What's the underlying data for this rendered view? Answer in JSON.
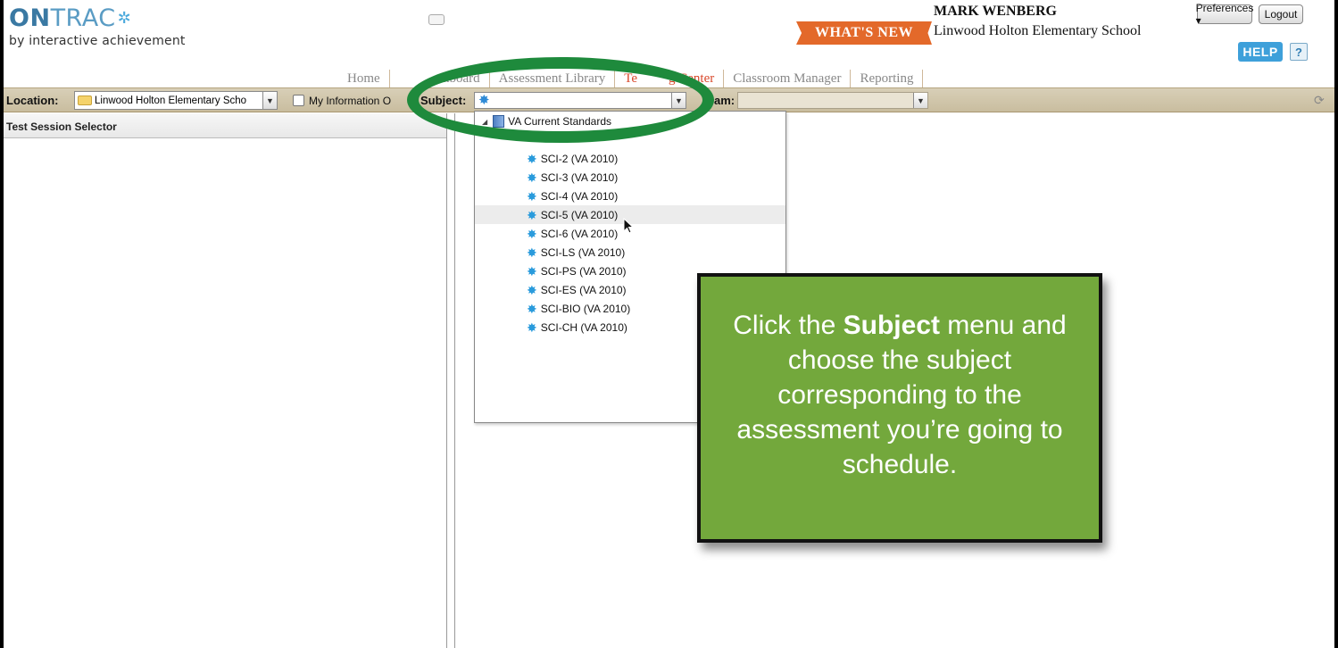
{
  "header": {
    "logo_on": "ON",
    "logo_trac": "TRAC",
    "logo_sub": "by interactive achievement",
    "whats_new": "WHAT'S NEW",
    "user_name": "MARK WENBERG",
    "user_school": "Linwood Holton Elementary School",
    "preferences_label": "Preferences ▾",
    "logout_label": "Logout",
    "help_label": "HELP",
    "question_label": "?"
  },
  "nav": {
    "items": [
      "Home",
      "Dashboard",
      "Assessment Library",
      "Testing Center",
      "Classroom Manager",
      "Reporting"
    ],
    "visible_items": [
      "Home",
      "hboard",
      "Assessment Library",
      "Te",
      "g Center",
      "Classroom Manager",
      "Reporting"
    ]
  },
  "toolbar": {
    "location_label": "Location:",
    "location_value": "Linwood Holton Elementary Scho",
    "my_info_label": "My Information O",
    "subject_label": "Subject:",
    "exam_label_suffix": "am:"
  },
  "left_panel": {
    "title": "Test Session Selector"
  },
  "subject_dropdown": {
    "root_label": "VA Current Standards",
    "items": [
      "SCI-2 (VA 2010)",
      "SCI-3 (VA 2010)",
      "SCI-4 (VA 2010)",
      "SCI-5 (VA 2010)",
      "SCI-6 (VA 2010)",
      "SCI-LS (VA 2010)",
      "SCI-PS (VA 2010)",
      "SCI-ES (VA 2010)",
      "SCI-BIO (VA 2010)",
      "SCI-CH (VA 2010)"
    ],
    "hovered_index": 3
  },
  "callout": {
    "prefix": "Click the ",
    "bold": "Subject",
    "suffix": " menu and choose the subject corresponding to the assessment you’re going to schedule."
  },
  "colors": {
    "annotation_ellipse": "#1e8a3c",
    "callout_bg": "#73a83c",
    "toolbar_bg": "#d0c6aa",
    "whats_new_bg": "#e3692a",
    "help_bg": "#3ea0da",
    "active_nav": "#d9482b"
  },
  "icons": {
    "subject_icon": "blue-star-icon",
    "folder": "folder-icon",
    "refresh": "refresh-icon",
    "tree_root": "book-icon"
  }
}
